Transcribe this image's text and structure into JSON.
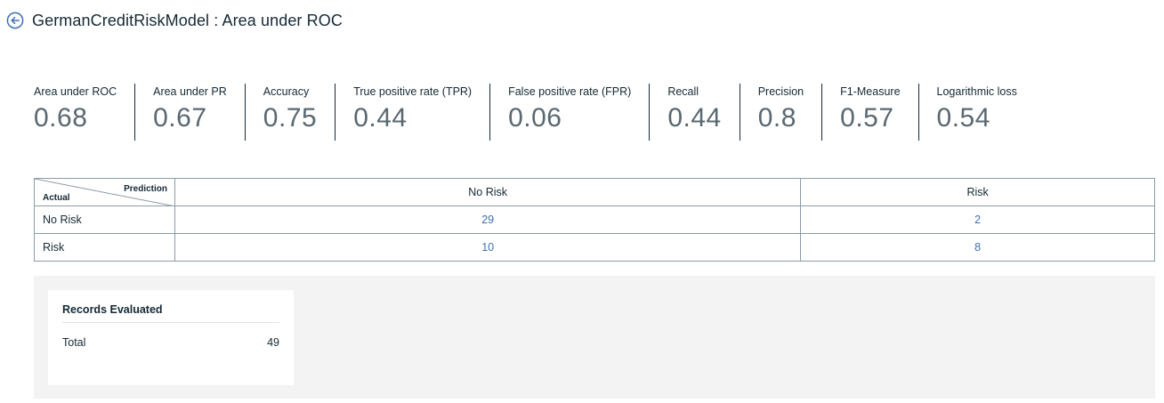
{
  "header": {
    "title": "GermanCreditRiskModel : Area under ROC"
  },
  "metrics": [
    {
      "label": "Area under ROC",
      "value": "0.68"
    },
    {
      "label": "Area under PR",
      "value": "0.67"
    },
    {
      "label": "Accuracy",
      "value": "0.75"
    },
    {
      "label": "True positive rate (TPR)",
      "value": "0.44"
    },
    {
      "label": "False positive rate (FPR)",
      "value": "0.06"
    },
    {
      "label": "Recall",
      "value": "0.44"
    },
    {
      "label": "Precision",
      "value": "0.8"
    },
    {
      "label": "F1-Measure",
      "value": "0.57"
    },
    {
      "label": "Logarithmic loss",
      "value": "0.54"
    }
  ],
  "matrix": {
    "prediction_label": "Prediction",
    "actual_label": "Actual",
    "columns": [
      "No Risk",
      "Risk"
    ],
    "rows": [
      {
        "label": "No Risk",
        "values": [
          "29",
          "2"
        ]
      },
      {
        "label": "Risk",
        "values": [
          "10",
          "8"
        ]
      }
    ]
  },
  "records": {
    "title": "Records Evaluated",
    "total_label": "Total",
    "total_value": "49"
  },
  "colors": {
    "accent": "#3d70b2",
    "text": "#152935",
    "metric_value": "#5a6872",
    "panel_bg": "#f3f3f3"
  },
  "icons": {
    "back": "arrow-left-circle-icon"
  }
}
